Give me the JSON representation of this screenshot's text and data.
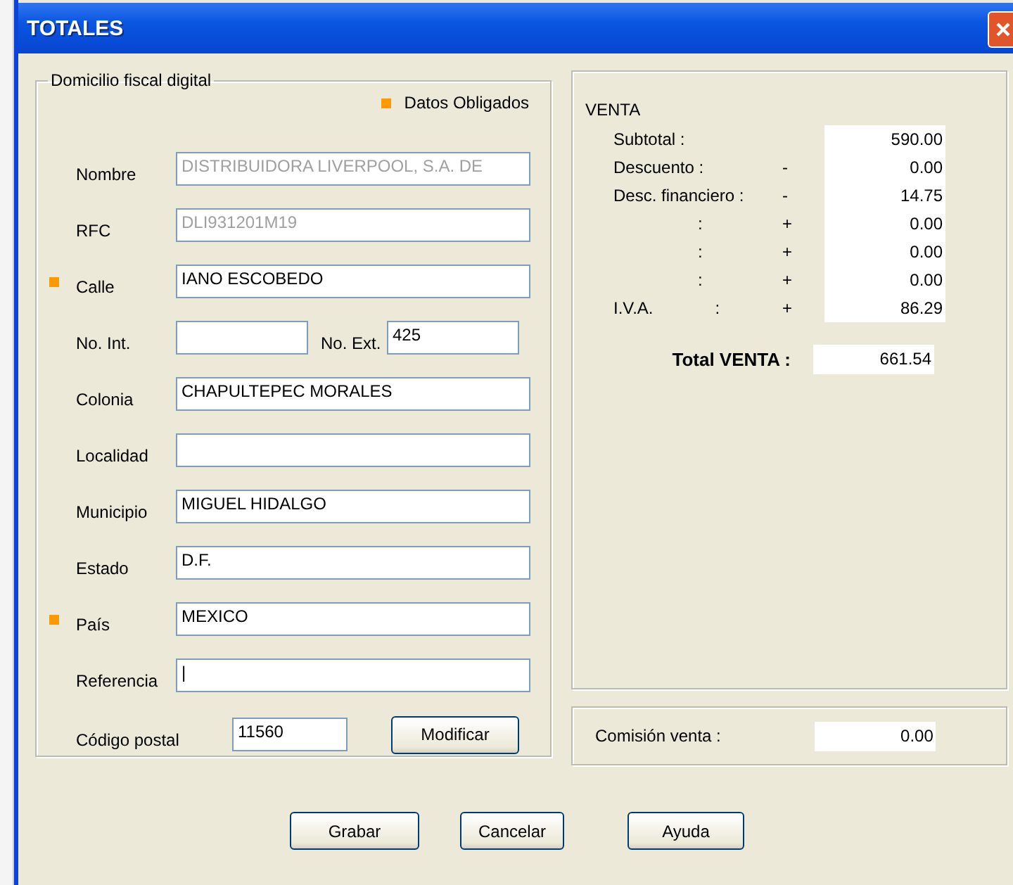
{
  "window": {
    "title": "TOTALES"
  },
  "address": {
    "title": "Domicilio fiscal digital",
    "legend": "Datos Obligados",
    "fields": [
      {
        "kind": "text",
        "label": "Nombre",
        "value": "DISTRIBUIDORA LIVERPOOL, S.A. DE",
        "disabled": true,
        "required": false
      },
      {
        "kind": "text",
        "label": "RFC",
        "value": "DLI931201M19",
        "disabled": true,
        "required": false
      },
      {
        "kind": "text",
        "label": "Calle",
        "value": "IANO ESCOBEDO",
        "disabled": false,
        "required": true
      },
      {
        "kind": "pair",
        "label": "No. Int.",
        "label_2": "No. Ext.",
        "value_2": "425",
        "disabled": false,
        "required": false
      },
      {
        "kind": "text",
        "label": "Colonia",
        "value": "CHAPULTEPEC MORALES",
        "disabled": false,
        "required": false
      },
      {
        "kind": "text",
        "label": "Localidad",
        "disabled": false,
        "required": false
      },
      {
        "kind": "text",
        "label": "Municipio",
        "value": "MIGUEL HIDALGO",
        "disabled": false,
        "required": false
      },
      {
        "kind": "text",
        "label": "Estado",
        "value": "D.F.",
        "disabled": false,
        "required": false
      },
      {
        "kind": "text",
        "label": "País",
        "value": "MEXICO",
        "disabled": false,
        "required": true
      },
      {
        "kind": "text",
        "label": "Referencia",
        "value": "|",
        "disabled": false,
        "required": false
      },
      {
        "kind": "postal",
        "label": "Código postal",
        "value": "11560",
        "button": "Modificar",
        "disabled": false,
        "required": false
      }
    ]
  },
  "venta": {
    "title": "VENTA",
    "rows": [
      {
        "kind": "named",
        "label": "Subtotal :",
        "value": "590.00"
      },
      {
        "kind": "named",
        "label": "Descuento :",
        "sign": "-",
        "value": "0.00"
      },
      {
        "kind": "named",
        "label": "Desc. financiero :",
        "sign": "-",
        "value": "14.75"
      },
      {
        "kind": "blank",
        "colon": ":",
        "sign": "+",
        "value": "0.00"
      },
      {
        "kind": "blank",
        "colon": ":",
        "sign": "+",
        "value": "0.00"
      },
      {
        "kind": "blank",
        "colon": ":",
        "sign": "+",
        "value": "0.00"
      },
      {
        "kind": "tax",
        "label": "I.V.A.",
        "colon": ":",
        "sign": "+",
        "value": "86.29"
      }
    ],
    "total_label": "Total VENTA :",
    "total": "661.54"
  },
  "commission": {
    "label": "Comisión venta :",
    "value": "0.00"
  },
  "buttons": [
    "Grabar",
    "Cancelar",
    "Ayuda"
  ]
}
